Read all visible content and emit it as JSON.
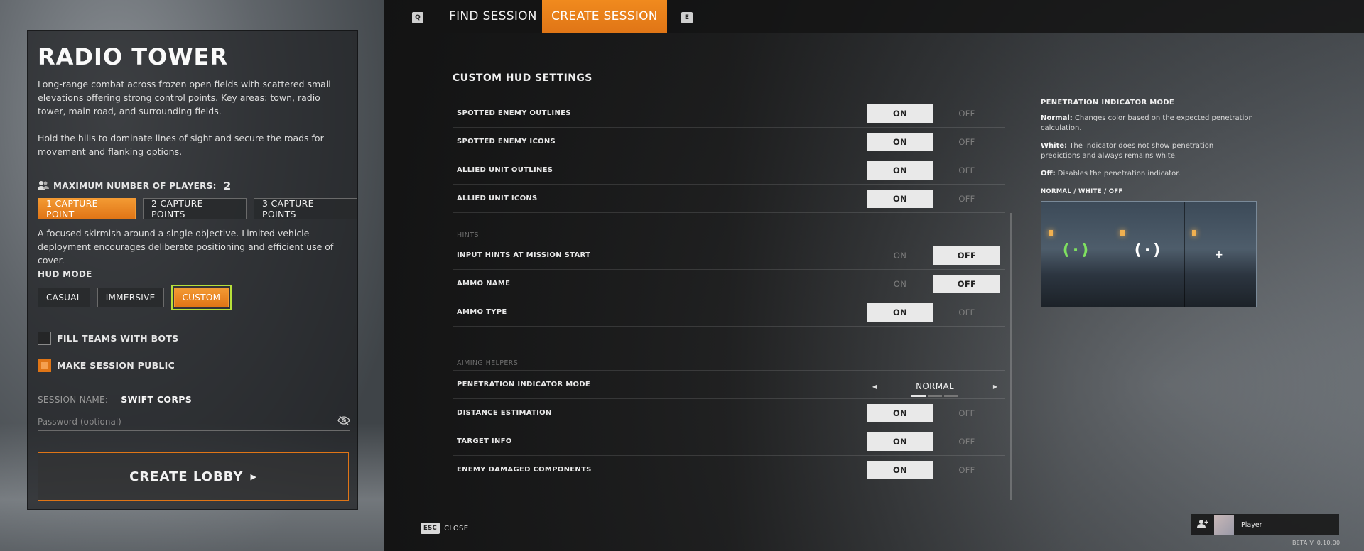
{
  "nav": {
    "q_key": "Q",
    "find_session": "FIND SESSION",
    "create_session": "CREATE SESSION",
    "e_key": "E"
  },
  "map": {
    "title": "RADIO TOWER",
    "description": "Long-range combat across frozen open fields with scattered small elevations offering strong control points. Key areas: town, radio tower, main road, and surrounding fields.",
    "description2": "Hold the hills to dominate lines of sight and secure the roads for movement and flanking options."
  },
  "players": {
    "label": "MAXIMUM NUMBER OF PLAYERS:",
    "value": "2",
    "icon": "users-icon"
  },
  "capture": {
    "options": [
      "1 CAPTURE POINT",
      "2 CAPTURE POINTS",
      "3 CAPTURE POINTS"
    ],
    "selected": 0,
    "description": "A focused skirmish around a single objective. Limited vehicle deployment encourages deliberate positioning and efficient use of cover."
  },
  "hud_mode": {
    "label": "HUD MODE",
    "options": [
      "CASUAL",
      "IMMERSIVE",
      "CUSTOM"
    ],
    "selected": 2
  },
  "checks": {
    "fill_bots": {
      "label": "FILL TEAMS WITH BOTS",
      "checked": false
    },
    "public": {
      "label": "MAKE SESSION PUBLIC",
      "checked": true
    }
  },
  "session": {
    "name_label": "SESSION NAME:",
    "name_value": "SWIFT CORPS",
    "password_placeholder": "Password (optional)"
  },
  "create_lobby": "CREATE LOBBY",
  "settings": {
    "title": "CUSTOM HUD SETTINGS",
    "on_label": "ON",
    "off_label": "OFF",
    "rows": [
      {
        "name": "SPOTTED ENEMY OUTLINES",
        "value": "ON"
      },
      {
        "name": "SPOTTED ENEMY ICONS",
        "value": "ON"
      },
      {
        "name": "ALLIED UNIT OUTLINES",
        "value": "ON"
      },
      {
        "name": "ALLIED UNIT ICONS",
        "value": "ON"
      }
    ],
    "hints_head": "HINTS",
    "hints_rows": [
      {
        "name": "INPUT HINTS AT MISSION START",
        "value": "OFF"
      },
      {
        "name": "AMMO NAME",
        "value": "OFF"
      },
      {
        "name": "AMMO TYPE",
        "value": "ON"
      }
    ],
    "aiming_head": "AIMING HELPERS",
    "penetration": {
      "name": "PENETRATION INDICATOR MODE",
      "value": "NORMAL",
      "option_index": 0,
      "option_count": 3
    },
    "aiming_rows": [
      {
        "name": "DISTANCE ESTIMATION",
        "value": "ON"
      },
      {
        "name": "TARGET INFO",
        "value": "ON"
      },
      {
        "name": "ENEMY DAMAGED COMPONENTS",
        "value": "ON"
      }
    ]
  },
  "info": {
    "title": "PENETRATION INDICATOR MODE",
    "normal_label": "Normal:",
    "normal_text": " Changes color based on the expected penetration calculation.",
    "white_label": "White:",
    "white_text": " The indicator does not show penetration predictions and always remains white.",
    "off_label": "Off:",
    "off_text": " Disables the penetration indicator.",
    "preview_label": "NORMAL / WHITE / OFF"
  },
  "footer": {
    "esc_key": "ESC",
    "close": "CLOSE",
    "player_name": "Player",
    "version": "BETA V. 0.10.00"
  },
  "colors": {
    "accent": "#e07516",
    "focus": "#b7e03a"
  }
}
